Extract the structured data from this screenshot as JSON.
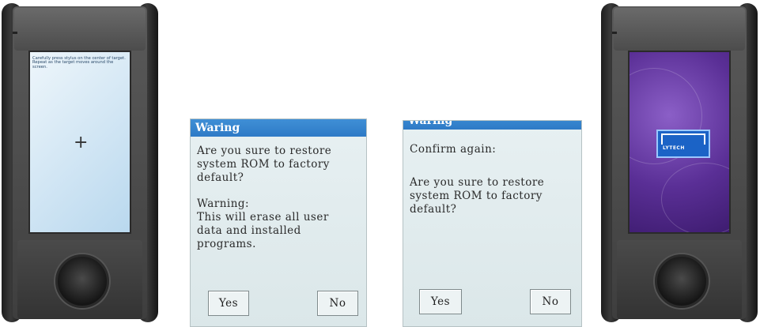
{
  "device_left": {
    "screen": {
      "instruction": "Carefully press stylus on the center of target. Repeat as the target moves around the screen.",
      "crosshair": "+"
    }
  },
  "dialog_1": {
    "title": "Waring",
    "question": "Are you sure to restore\nsystem ROM to factory\ndefault?",
    "warning_heading": "Warning:",
    "warning_body": "This will erase all user\ndata and installed\nprograms.",
    "yes_label": "Yes",
    "no_label": "No"
  },
  "dialog_2": {
    "title": "Waring",
    "confirm": "Confirm again:",
    "question": "Are you sure to restore\nsystem ROM to factory\ndefault?",
    "yes_label": "Yes",
    "no_label": "No"
  },
  "device_right": {
    "screen": {
      "logo_text": "LYTECH"
    }
  },
  "colors": {
    "title_bar": "#2e7ac6",
    "dialog_bg": "#e2ecee",
    "splash_bg": "#5a2f96",
    "calib_bg": "#cfe4f3"
  }
}
